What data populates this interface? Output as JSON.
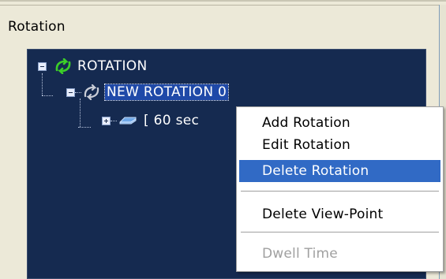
{
  "group": {
    "label": "Rotation"
  },
  "tree": {
    "root": {
      "label": "ROTATION",
      "icon": "rotation-green-icon",
      "expanded": true
    },
    "child": {
      "label": "NEW ROTATION 0",
      "icon": "rotation-grey-icon",
      "expanded": true,
      "selected": true
    },
    "grandchild": {
      "label": "[  60 sec",
      "icon": "viewpoint-icon",
      "expanded": false
    }
  },
  "context_menu": {
    "items": [
      {
        "label": "Add Rotation",
        "state": "normal"
      },
      {
        "label": "Edit Rotation",
        "state": "normal"
      },
      {
        "label": "Delete Rotation",
        "state": "highlighted"
      },
      {
        "label": "Delete View-Point",
        "state": "normal"
      },
      {
        "label": "Dwell Time",
        "state": "disabled"
      }
    ]
  },
  "colors": {
    "tree_background": "#152a50",
    "selection": "#1f49a8",
    "menu_highlight": "#316ac5",
    "window_background": "#ece9d8"
  }
}
